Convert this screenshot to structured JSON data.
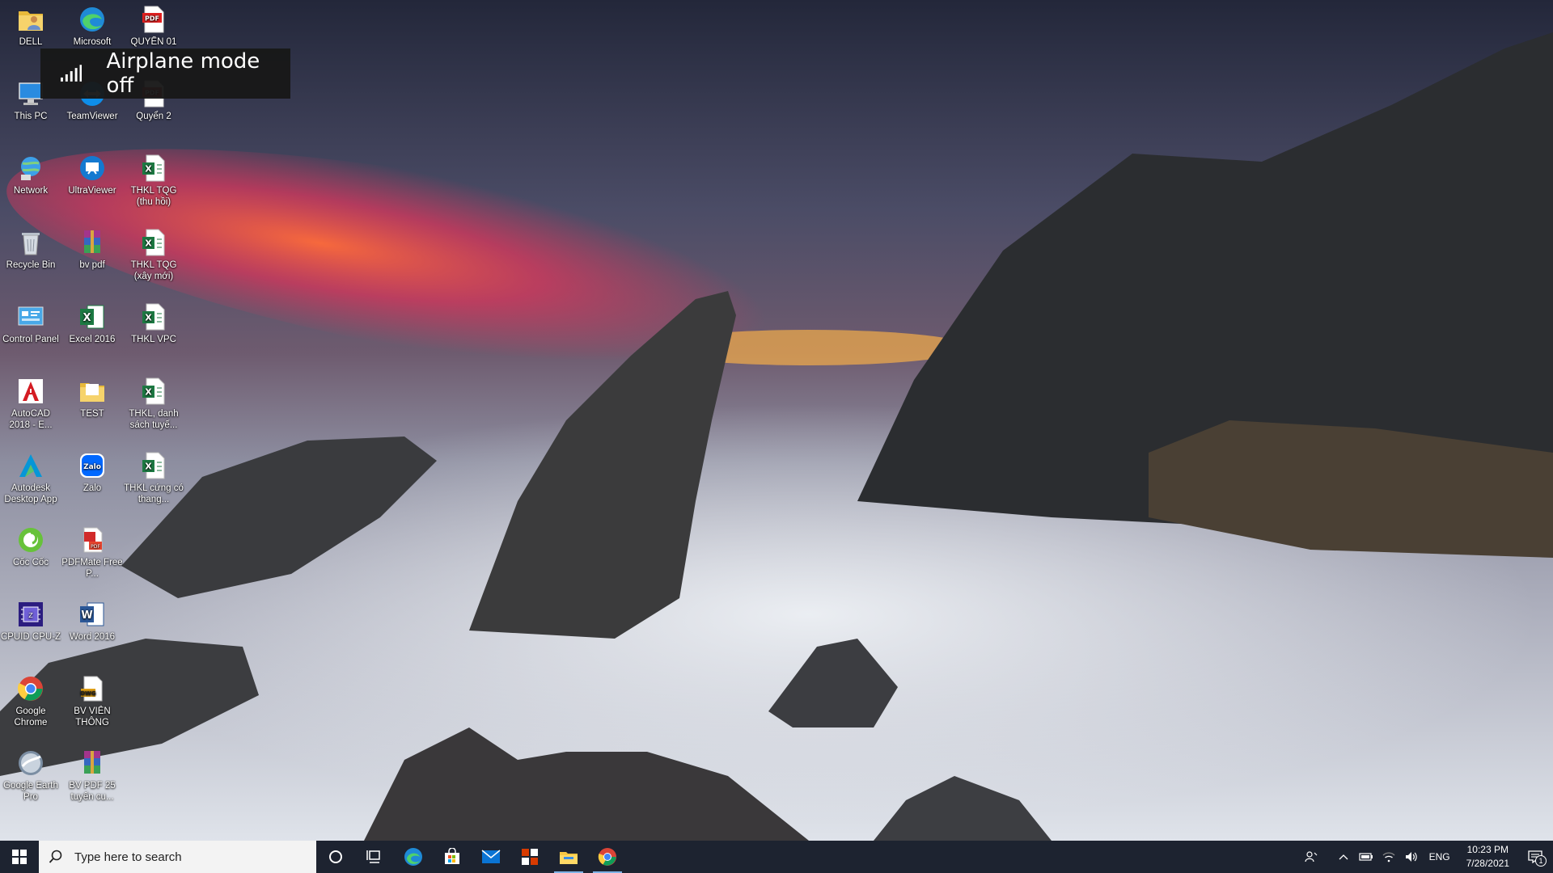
{
  "notification": {
    "text": "Airplane mode off",
    "icon": "signal-bars-icon"
  },
  "desktop_icons": [
    {
      "label": "DELL",
      "icon": "user-folder-icon"
    },
    {
      "label": "Microsoft",
      "icon": "edge-icon"
    },
    {
      "label": "QUYỂN 01",
      "icon": "pdf-icon"
    },
    {
      "label": "This PC",
      "icon": "computer-icon"
    },
    {
      "label": "TeamViewer",
      "icon": "teamviewer-icon"
    },
    {
      "label": "Quyển 2",
      "icon": "pdf-icon"
    },
    {
      "label": "Network",
      "icon": "network-icon"
    },
    {
      "label": "UltraViewer",
      "icon": "ultraviewer-icon"
    },
    {
      "label": "THKL TQG (thu hồi)",
      "icon": "excel-file-icon"
    },
    {
      "label": "Recycle Bin",
      "icon": "recycle-bin-icon"
    },
    {
      "label": "bv pdf",
      "icon": "winrar-icon"
    },
    {
      "label": "THKL TQG (xây mới)",
      "icon": "excel-file-icon"
    },
    {
      "label": "Control Panel",
      "icon": "control-panel-icon"
    },
    {
      "label": "Excel 2016",
      "icon": "excel-icon"
    },
    {
      "label": "THKL VPC",
      "icon": "excel-file-icon"
    },
    {
      "label": "AutoCAD 2018 - E...",
      "icon": "autocad-icon"
    },
    {
      "label": "TEST",
      "icon": "folder-icon"
    },
    {
      "label": "THKL, danh sách tuyế...",
      "icon": "excel-file-icon"
    },
    {
      "label": "Autodesk Desktop App",
      "icon": "autodesk-icon"
    },
    {
      "label": "Zalo",
      "icon": "zalo-icon"
    },
    {
      "label": "THKL cứng có thang...",
      "icon": "excel-file-icon"
    },
    {
      "label": "Cốc Cốc",
      "icon": "coccoc-icon"
    },
    {
      "label": "PDFMate Free P...",
      "icon": "pdfmate-icon"
    },
    {
      "label": "CPUID CPU-Z",
      "icon": "cpuz-icon"
    },
    {
      "label": "Word 2016",
      "icon": "word-icon"
    },
    {
      "label": "Google Chrome",
      "icon": "chrome-icon"
    },
    {
      "label": "BV VIỄN THÔNG",
      "icon": "dwg-file-icon"
    },
    {
      "label": "Google Earth Pro",
      "icon": "google-earth-icon"
    },
    {
      "label": "BV PDF 25 tuyến cu...",
      "icon": "winrar-icon"
    }
  ],
  "taskbar": {
    "search_placeholder": "Type here to search",
    "apps": [
      "cortana-icon",
      "task-view-icon",
      "edge-icon",
      "store-icon",
      "mail-icon",
      "office-icon",
      "file-explorer-icon",
      "chrome-icon"
    ],
    "tray": {
      "language": "ENG",
      "time": "10:23 PM",
      "date": "7/28/2021",
      "notification_count": "1"
    }
  }
}
